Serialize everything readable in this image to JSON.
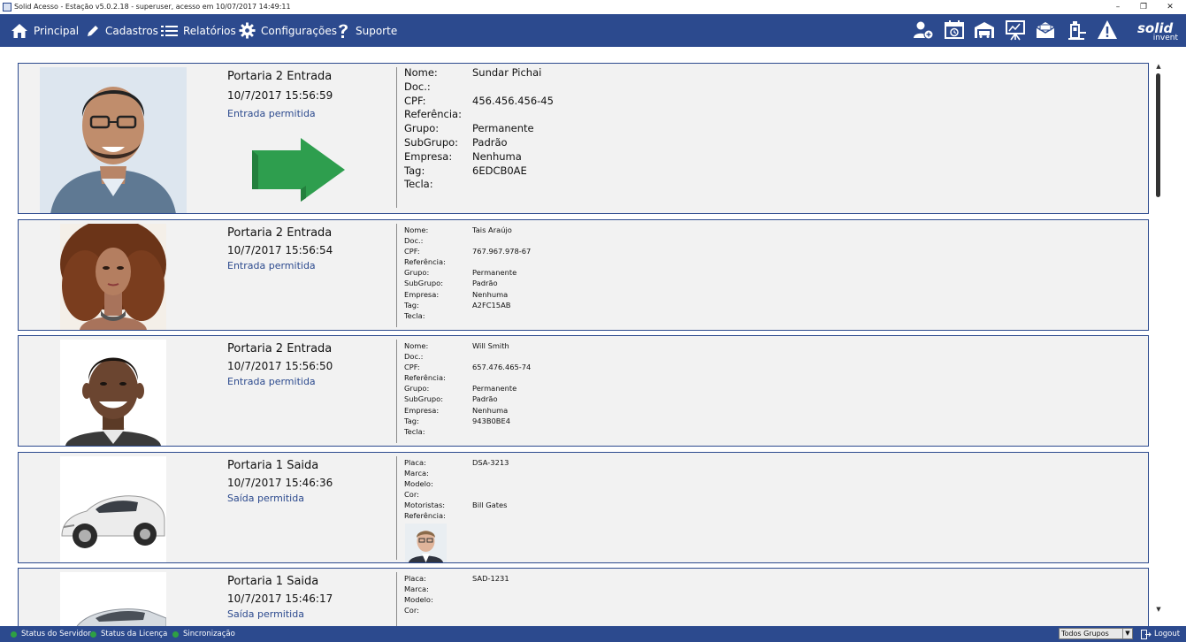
{
  "window": {
    "title": "Solid Acesso - Estação v5.0.2.18 - superuser, acesso em 10/07/2017 14:49:11",
    "minimize": "–",
    "restore": "❐",
    "close": "✕"
  },
  "toolbar": {
    "nav": [
      {
        "label": "Principal",
        "icon": "home-icon"
      },
      {
        "label": "Cadastros",
        "icon": "pencil-icon"
      },
      {
        "label": "Relatórios",
        "icon": "list-icon"
      },
      {
        "label": "Configurações",
        "icon": "gear-icon"
      },
      {
        "label": "Suporte",
        "icon": "question-icon"
      }
    ],
    "right_icons": [
      "add-user-icon",
      "calendar-clock-icon",
      "garage-icon",
      "presentation-icon",
      "mail-icon",
      "guard-booth-icon",
      "warning-icon"
    ],
    "logo": {
      "main": "solid",
      "sub": "invent"
    },
    "accent": "#2c4a8e"
  },
  "events": [
    {
      "place": "Portaria 2 Entrada",
      "time": "10/7/2017 15:56:59",
      "status": "Entrada permitida",
      "fields": [
        {
          "label": "Nome:",
          "value": "Sundar Pichai"
        },
        {
          "label": "Doc.:",
          "value": ""
        },
        {
          "label": "CPF:",
          "value": "456.456.456-45"
        },
        {
          "label": "Referência:",
          "value": ""
        },
        {
          "label": "Grupo:",
          "value": "Permanente"
        },
        {
          "label": "SubGrupo:",
          "value": "Padrão"
        },
        {
          "label": "Empresa:",
          "value": "Nenhuma"
        },
        {
          "label": "Tag:",
          "value": "6EDCB0AE"
        },
        {
          "label": "Tecla:",
          "value": ""
        }
      ]
    },
    {
      "place": "Portaria 2 Entrada",
      "time": "10/7/2017 15:56:54",
      "status": "Entrada permitida",
      "fields": [
        {
          "label": "Nome:",
          "value": "Tais Araújo"
        },
        {
          "label": "Doc.:",
          "value": ""
        },
        {
          "label": "CPF:",
          "value": "767.967.978-67"
        },
        {
          "label": "Referência:",
          "value": ""
        },
        {
          "label": "Grupo:",
          "value": "Permanente"
        },
        {
          "label": "SubGrupo:",
          "value": "Padrão"
        },
        {
          "label": "Empresa:",
          "value": "Nenhuma"
        },
        {
          "label": "Tag:",
          "value": "A2FC15AB"
        },
        {
          "label": "Tecla:",
          "value": ""
        }
      ]
    },
    {
      "place": "Portaria 2 Entrada",
      "time": "10/7/2017 15:56:50",
      "status": "Entrada permitida",
      "fields": [
        {
          "label": "Nome:",
          "value": "Will Smith"
        },
        {
          "label": "Doc.:",
          "value": ""
        },
        {
          "label": "CPF:",
          "value": "657.476.465-74"
        },
        {
          "label": "Referência:",
          "value": ""
        },
        {
          "label": "Grupo:",
          "value": "Permanente"
        },
        {
          "label": "SubGrupo:",
          "value": "Padrão"
        },
        {
          "label": "Empresa:",
          "value": "Nenhuma"
        },
        {
          "label": "Tag:",
          "value": "943B0BE4"
        },
        {
          "label": "Tecla:",
          "value": ""
        }
      ]
    },
    {
      "place": "Portaria 1 Saida",
      "time": "10/7/2017 15:46:36",
      "status": "Saída permitida",
      "fields": [
        {
          "label": "Placa:",
          "value": "DSA-3213"
        },
        {
          "label": "Marca:",
          "value": ""
        },
        {
          "label": "Modelo:",
          "value": ""
        },
        {
          "label": "Cor:",
          "value": ""
        },
        {
          "label": "Motoristas:",
          "value": "Bill Gates"
        },
        {
          "label": "Referência:",
          "value": ""
        }
      ]
    },
    {
      "place": "Portaria 1 Saida",
      "time": "10/7/2017 15:46:17",
      "status": "Saída permitida",
      "fields": [
        {
          "label": "Placa:",
          "value": "SAD-1231"
        },
        {
          "label": "Marca:",
          "value": ""
        },
        {
          "label": "Modelo:",
          "value": ""
        },
        {
          "label": "Cor:",
          "value": ""
        }
      ]
    }
  ],
  "statusbar": {
    "items": [
      "Status do Servidor",
      "Status da Licença",
      "Sincronização"
    ],
    "group_select": "Todos Grupos",
    "logout": "Logout"
  }
}
